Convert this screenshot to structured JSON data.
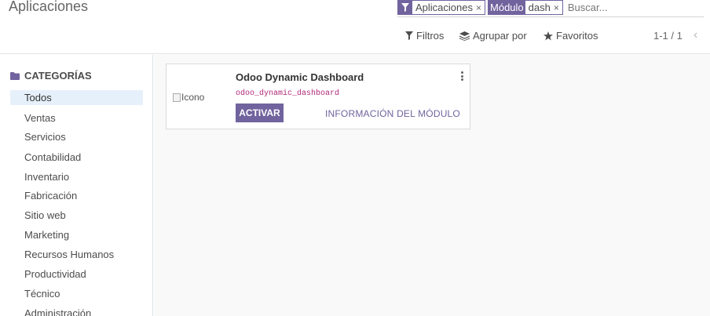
{
  "header": {
    "title": "Aplicaciones"
  },
  "search": {
    "facets": [
      {
        "label": "",
        "value": "Aplicaciones",
        "icon": "filter-icon"
      },
      {
        "label": "Módulo",
        "value": "dash",
        "icon": ""
      }
    ],
    "close_glyph": "×",
    "placeholder": "Buscar..."
  },
  "toolbar": {
    "filters_label": "Filtros",
    "group_by_label": "Agrupar por",
    "favorites_label": "Favoritos",
    "pager": "1-1 / 1",
    "prev_glyph": "‹"
  },
  "sidebar": {
    "header": "CATEGORÍAS",
    "items": [
      {
        "label": "Todos",
        "active": true
      },
      {
        "label": "Ventas"
      },
      {
        "label": "Servicios"
      },
      {
        "label": "Contabilidad"
      },
      {
        "label": "Inventario"
      },
      {
        "label": "Fabricación"
      },
      {
        "label": "Sitio web"
      },
      {
        "label": "Marketing"
      },
      {
        "label": "Recursos Humanos"
      },
      {
        "label": "Productividad"
      },
      {
        "label": "Técnico"
      },
      {
        "label": "Administración"
      }
    ]
  },
  "module": {
    "icon_alt": "Icono",
    "name": "Odoo Dynamic Dashboard",
    "technical_name": "odoo_dynamic_dashboard",
    "activate_label": "ACTIVAR",
    "info_label": "INFORMACIÓN DEL MÓDULO"
  },
  "colors": {
    "brand": "#71639e",
    "active_bg": "#e6f0fa",
    "technical_name": "#b0287a"
  }
}
